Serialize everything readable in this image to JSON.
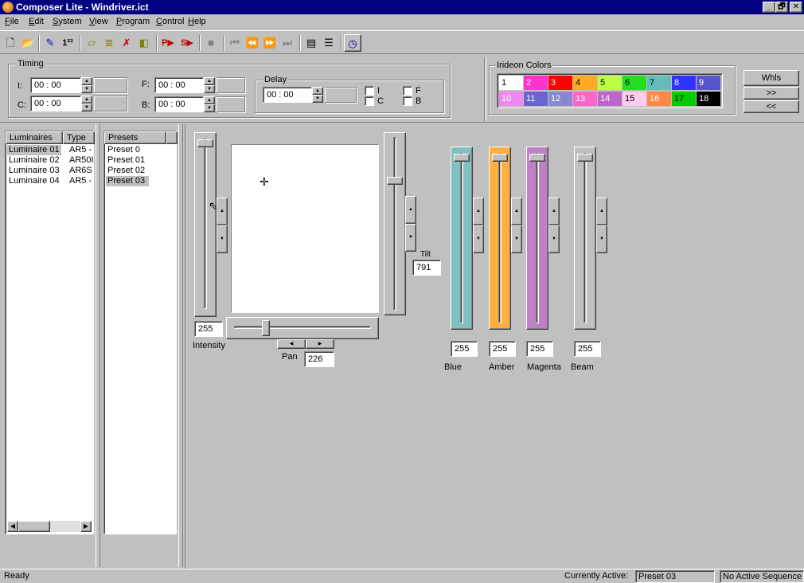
{
  "window": {
    "title": "Composer Lite - Windriver.ict",
    "minimize": "_",
    "restore": "🗗",
    "close": "✕"
  },
  "menu": [
    "File",
    "Edit",
    "System",
    "View",
    "Program",
    "Control",
    "Help"
  ],
  "timing": {
    "label": "Timing",
    "i_label": "I:",
    "i_value": "00  :  00",
    "c_label": "C:",
    "c_value": "00  :  00",
    "f_label": "F:",
    "f_value": "00  :  00",
    "b_label": "B:",
    "b_value": "00  :  00",
    "delay_label": "Delay",
    "delay_value": "00  :  00",
    "checkboxes": [
      "I",
      "F",
      "C",
      "B"
    ]
  },
  "irideon": {
    "label": "Irideon Colors",
    "swatches": [
      {
        "num": "1",
        "color": "#ffffff",
        "text": "#000000"
      },
      {
        "num": "2",
        "color": "#ff33cc",
        "text": "#ffffff"
      },
      {
        "num": "3",
        "color": "#ff0000",
        "text": "#ffffff"
      },
      {
        "num": "4",
        "color": "#ffaa22",
        "text": "#000000"
      },
      {
        "num": "5",
        "color": "#bbff44",
        "text": "#000000"
      },
      {
        "num": "6",
        "color": "#22dd22",
        "text": "#000000"
      },
      {
        "num": "7",
        "color": "#66bbbb",
        "text": "#000000"
      },
      {
        "num": "8",
        "color": "#3333ff",
        "text": "#ffffff"
      },
      {
        "num": "9",
        "color": "#5555cc",
        "text": "#ffffff"
      },
      {
        "num": "10",
        "color": "#ee88ee",
        "text": "#ffffff"
      },
      {
        "num": "11",
        "color": "#6666cc",
        "text": "#ffffff"
      },
      {
        "num": "12",
        "color": "#8888cc",
        "text": "#ffffff"
      },
      {
        "num": "13",
        "color": "#ff66cc",
        "text": "#ffffff"
      },
      {
        "num": "14",
        "color": "#bb66cc",
        "text": "#ffffff"
      },
      {
        "num": "15",
        "color": "#ffccee",
        "text": "#000000"
      },
      {
        "num": "16",
        "color": "#ff8844",
        "text": "#ffffff"
      },
      {
        "num": "17",
        "color": "#00cc00",
        "text": "#000000"
      },
      {
        "num": "18",
        "color": "#000000",
        "text": "#ffffff"
      }
    ],
    "btn_whls": "Whls",
    "btn_next": ">>",
    "btn_prev": "<<"
  },
  "luminaires": {
    "col1": "Luminaires",
    "col2": "Type",
    "rows": [
      {
        "name": "Luminaire 01",
        "type": "AR5 -"
      },
      {
        "name": "Luminaire 02",
        "type": "AR50I"
      },
      {
        "name": "Luminaire 03",
        "type": "AR6S"
      },
      {
        "name": "Luminaire 04",
        "type": "AR5 -"
      }
    ]
  },
  "presets": {
    "col1": "Presets",
    "rows": [
      "Preset 0",
      "Preset 01",
      "Preset 02",
      "Preset 03"
    ]
  },
  "controls": {
    "intensity_value": "255",
    "intensity_label": "Intensity",
    "tilt_label": "Tilt",
    "tilt_value": "791",
    "pan_label": "Pan",
    "pan_value": "226",
    "crosshair": "✛",
    "colors": [
      {
        "label": "Blue",
        "value": "255",
        "color": "#80c0c0"
      },
      {
        "label": "Amber",
        "value": "255",
        "color": "#ffb040"
      },
      {
        "label": "Magenta",
        "value": "255",
        "color": "#c080c8"
      },
      {
        "label": "Beam",
        "value": "255",
        "color": "#c0c0c0"
      }
    ]
  },
  "status": {
    "left": "Ready",
    "active_label": "Currently Active:",
    "active_value": "Preset 03",
    "sequence": "No Active Sequence"
  }
}
